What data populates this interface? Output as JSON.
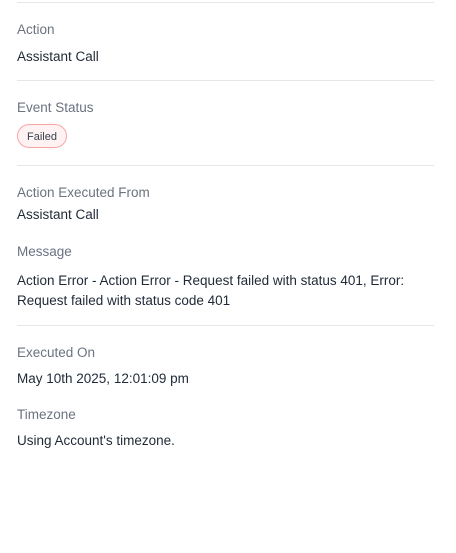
{
  "fields": {
    "action": {
      "label": "Action",
      "value": "Assistant Call"
    },
    "event_status": {
      "label": "Event Status",
      "value": "Failed"
    },
    "executed_from": {
      "label": "Action Executed From",
      "value": "Assistant Call"
    },
    "message": {
      "label": "Message",
      "value": "Action Error - Action Error - Request failed with status 401, Error: Request failed with status code 401"
    },
    "executed_on": {
      "label": "Executed On",
      "value": "May 10th 2025, 12:01:09 pm"
    },
    "timezone": {
      "label": "Timezone",
      "value": "Using Account's timezone."
    }
  },
  "colors": {
    "status_failed_bg": "#fef2f2",
    "status_failed_border": "#fca5a5"
  }
}
